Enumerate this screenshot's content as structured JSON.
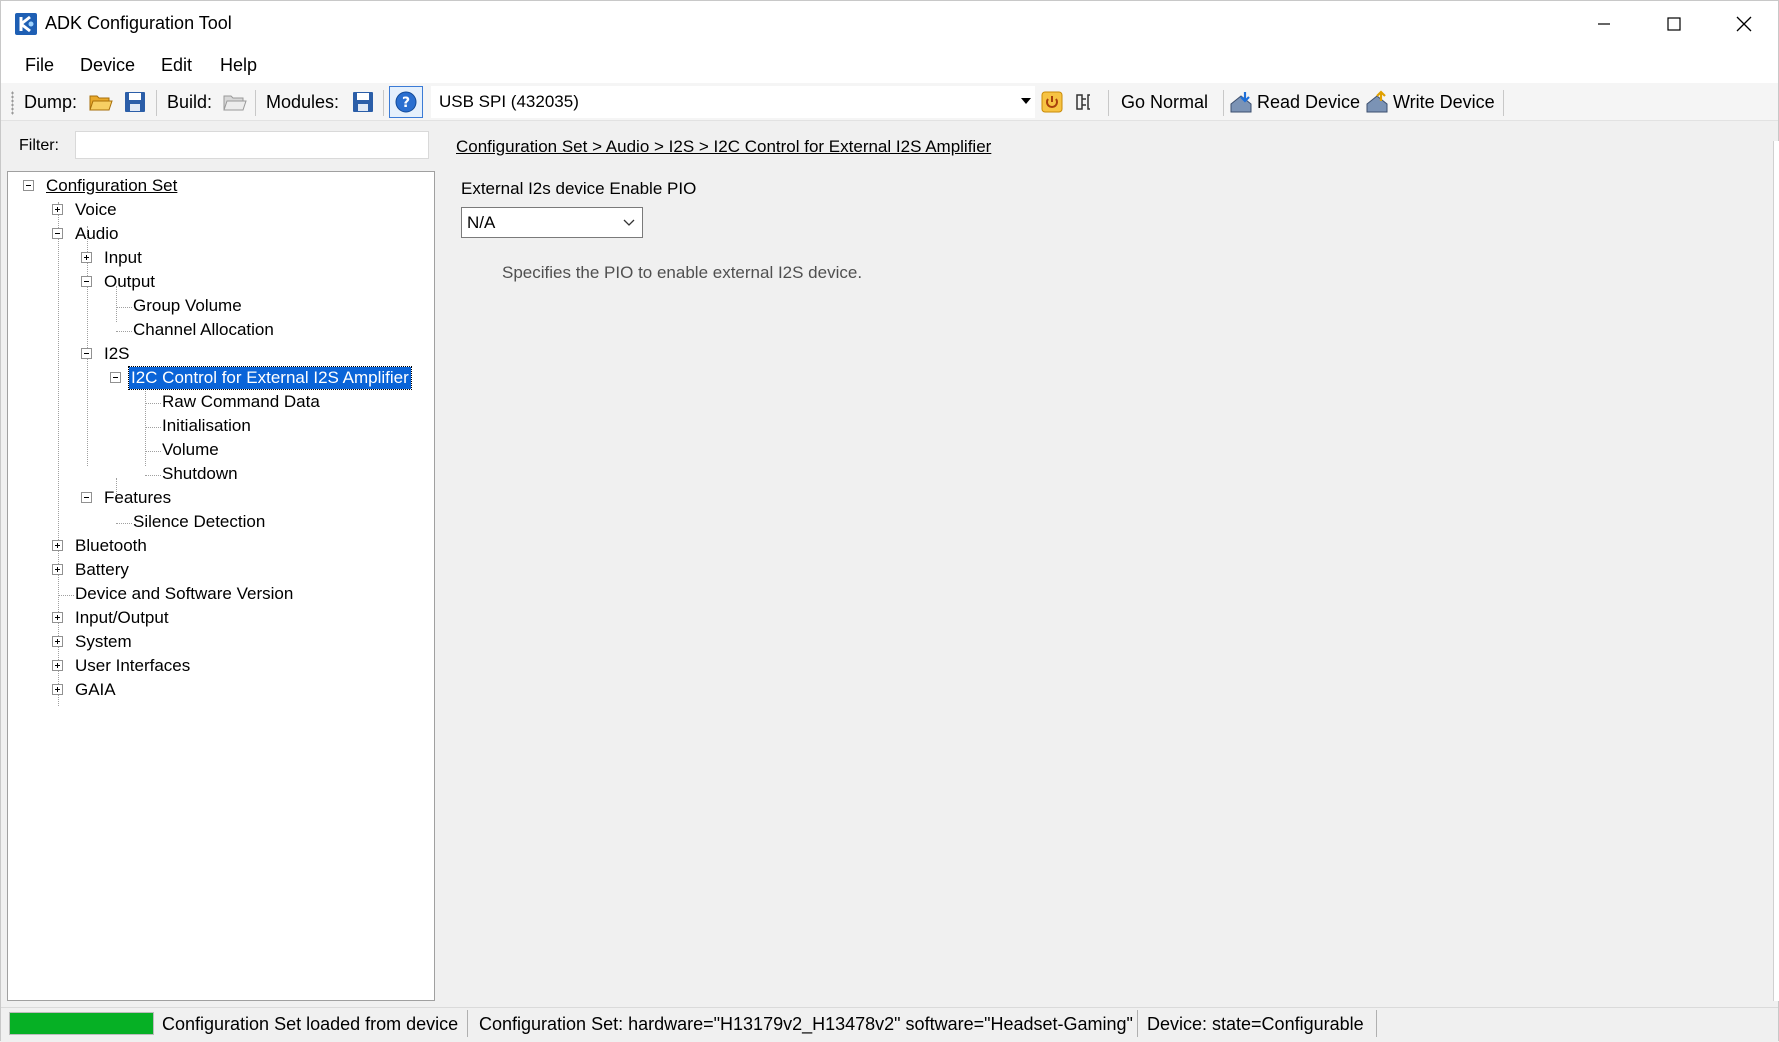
{
  "window": {
    "title": "ADK Configuration Tool"
  },
  "menu": {
    "items": [
      "File",
      "Device",
      "Edit",
      "Help"
    ]
  },
  "toolbar": {
    "dump_label": "Dump:",
    "build_label": "Build:",
    "modules_label": "Modules:",
    "connection_value": "USB SPI (432035)",
    "go_normal": "Go Normal",
    "read_device": "Read Device",
    "write_device": "Write Device"
  },
  "filter": {
    "label": "Filter:",
    "value": ""
  },
  "tree": {
    "items": [
      {
        "label": "Configuration Set",
        "state": "expanded"
      },
      {
        "label": "Voice",
        "state": "collapsed"
      },
      {
        "label": "Audio",
        "state": "expanded"
      },
      {
        "label": "Input",
        "state": "collapsed"
      },
      {
        "label": "Output",
        "state": "expanded"
      },
      {
        "label": "Group Volume",
        "state": "leaf"
      },
      {
        "label": "Channel Allocation",
        "state": "leaf"
      },
      {
        "label": "I2S",
        "state": "expanded"
      },
      {
        "label": "I2C Control for External I2S Amplifier",
        "state": "expanded",
        "selected": true
      },
      {
        "label": "Raw Command Data",
        "state": "leaf"
      },
      {
        "label": "Initialisation",
        "state": "leaf"
      },
      {
        "label": "Volume",
        "state": "leaf"
      },
      {
        "label": "Shutdown",
        "state": "leaf"
      },
      {
        "label": "Features",
        "state": "expanded"
      },
      {
        "label": "Silence Detection",
        "state": "leaf"
      },
      {
        "label": "Bluetooth",
        "state": "collapsed"
      },
      {
        "label": "Battery",
        "state": "collapsed"
      },
      {
        "label": "Device and Software Version",
        "state": "leaf"
      },
      {
        "label": "Input/Output",
        "state": "collapsed"
      },
      {
        "label": "System",
        "state": "collapsed"
      },
      {
        "label": "User Interfaces",
        "state": "collapsed"
      },
      {
        "label": "GAIA",
        "state": "collapsed"
      }
    ]
  },
  "detail": {
    "breadcrumb": "Configuration Set > Audio > I2S > I2C Control for External I2S Amplifier",
    "field_label": "External I2s device Enable PIO",
    "field_value": "N/A",
    "description": "Specifies the PIO to enable external I2S device."
  },
  "status": {
    "progress_fraction": 1.0,
    "message": "Configuration Set loaded from device",
    "config_set": "Configuration Set:  hardware=\"H13179v2_H13478v2\" software=\"Headset-Gaming\"",
    "device": "Device:  state=Configurable"
  },
  "colors": {
    "selection": "#0a64d8",
    "progress": "#06b025",
    "accent_blue": "#1e5fb4",
    "folder_yellow": "#f2b53a"
  }
}
